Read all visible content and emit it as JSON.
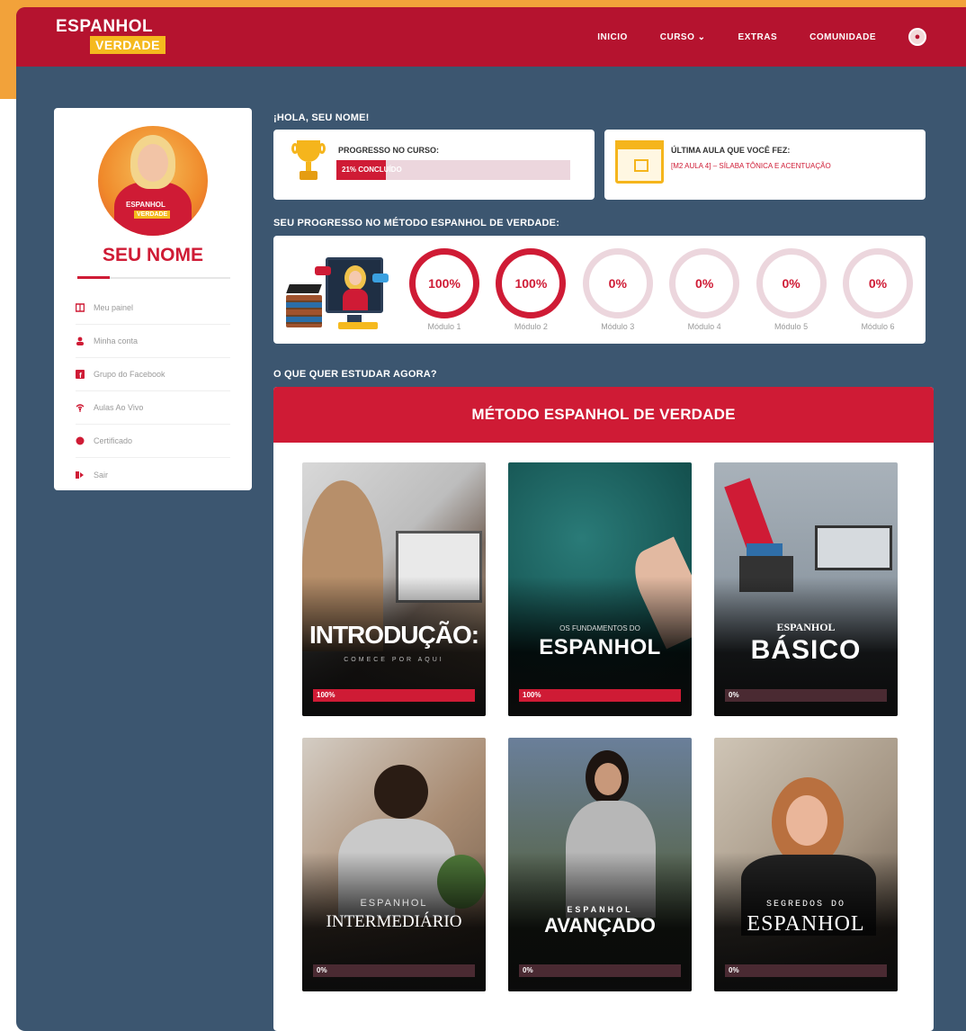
{
  "brand": {
    "logo_top": "ESPANHOL",
    "logo_bottom": "VERDADE"
  },
  "nav": {
    "items": [
      {
        "label": "INICIO"
      },
      {
        "label": "CURSO ⌄"
      },
      {
        "label": "EXTRAS"
      },
      {
        "label": "COMUNIDADE"
      }
    ]
  },
  "sidebar": {
    "name": "SEU NOME",
    "badge_a": "ESPANHOL",
    "badge_b": "VERDADE",
    "items": [
      {
        "label": "Meu painel",
        "icon": "dashboard-icon"
      },
      {
        "label": "Minha conta",
        "icon": "user-icon"
      },
      {
        "label": "Grupo do Facebook",
        "icon": "facebook-icon"
      },
      {
        "label": "Aulas Ao Vivo",
        "icon": "broadcast-icon"
      },
      {
        "label": "Certificado",
        "icon": "certificate-icon"
      },
      {
        "label": "Sair",
        "icon": "logout-icon"
      }
    ]
  },
  "greeting": "¡HOLA, SEU NOME!",
  "progress": {
    "label": "PROGRESSO NO CURSO:",
    "text": "21% CONCLUÍDO",
    "value": 0.21
  },
  "last_lesson": {
    "label": "ÚLTIMA AULA QUE VOCÊ FEZ:",
    "link": "[M2 AULA 4] – SÍLABA TÔNICA E ACENTUAÇÃO"
  },
  "method_progress": {
    "title": "SEU PROGRESSO NO MÉTODO ESPANHOL DE VERDADE:",
    "modules": [
      {
        "label": "Módulo 1",
        "percent": "100%"
      },
      {
        "label": "Módulo 2",
        "percent": "100%"
      },
      {
        "label": "Módulo 3",
        "percent": "0%"
      },
      {
        "label": "Módulo 4",
        "percent": "0%"
      },
      {
        "label": "Módulo 5",
        "percent": "0%"
      },
      {
        "label": "Módulo 6",
        "percent": "0%"
      }
    ]
  },
  "study": {
    "title": "O QUE QUER ESTUDAR AGORA?",
    "header": "MÉTODO ESPANHOL DE VERDADE",
    "courses": [
      {
        "title": "INTRODUÇÃO:",
        "subtitle": "COMECE POR AQUI",
        "percent": "100%",
        "value": 1.0
      },
      {
        "title": "ESPANHOL",
        "subtitle": "OS FUNDAMENTOS DO",
        "percent": "100%",
        "value": 1.0
      },
      {
        "title": "BÁSICO",
        "subtitle": "ESPANHOL",
        "percent": "0%",
        "value": 0
      },
      {
        "title": "INTERMEDIÁRIO",
        "subtitle": "ESPANHOL",
        "percent": "0%",
        "value": 0
      },
      {
        "title": "AVANÇADO",
        "subtitle": "ESPANHOL",
        "percent": "0%",
        "value": 0
      },
      {
        "title": "ESPANHOL",
        "subtitle": "SEGREDOS DO",
        "percent": "0%",
        "value": 0
      }
    ]
  },
  "colors": {
    "brand_red": "#cf1b35",
    "nav_red": "#b5132f",
    "background": "#3c5670",
    "accent_yellow": "#f5b91e"
  }
}
